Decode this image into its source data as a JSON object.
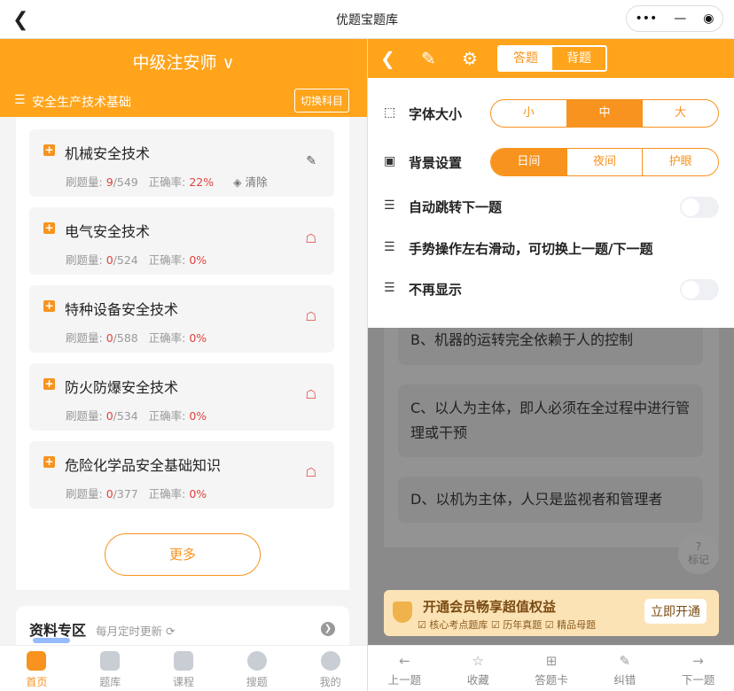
{
  "app": {
    "title": "优题宝题库"
  },
  "capsule": {
    "more": "•••",
    "min": "—",
    "close": "◉"
  },
  "left": {
    "exam": "中级注安师",
    "subject": "安全生产技术基础",
    "switch_label": "切换科目",
    "items": [
      {
        "name": "机械安全技术",
        "done_label": "刷题量:",
        "done": "9",
        "total": "/549",
        "rate_label": "正确率:",
        "rate": "22%",
        "clear": "清除"
      },
      {
        "name": "电气安全技术",
        "done_label": "刷题量:",
        "done": "0",
        "total": "/524",
        "rate_label": "正确率:",
        "rate": "0%"
      },
      {
        "name": "特种设备安全技术",
        "done_label": "刷题量:",
        "done": "0",
        "total": "/588",
        "rate_label": "正确率:",
        "rate": "0%"
      },
      {
        "name": "防火防爆安全技术",
        "done_label": "刷题量:",
        "done": "0",
        "total": "/534",
        "rate_label": "正确率:",
        "rate": "0%"
      },
      {
        "name": "危险化学品安全基础知识",
        "done_label": "刷题量:",
        "done": "0",
        "total": "/377",
        "rate_label": "正确率:",
        "rate": "0%"
      }
    ],
    "more": "更多",
    "materials": {
      "title": "资料专区",
      "subtitle": "每月定时更新"
    },
    "nav": [
      "首页",
      "题库",
      "课程",
      "搜题",
      "我的"
    ]
  },
  "right": {
    "mode": {
      "answer": "答题",
      "recite": "背题"
    },
    "settings": {
      "font_label": "字体大小",
      "font_opts": [
        "小",
        "中",
        "大"
      ],
      "bg_label": "背景设置",
      "bg_opts": [
        "日间",
        "夜间",
        "护眼"
      ],
      "auto_next": "自动跳转下一题",
      "gesture": "手势操作左右滑动，可切换上一题/下一题",
      "no_show": "不再显示"
    },
    "options": {
      "b": "B、机器的运转完全依赖于人的控制",
      "c": "C、以人为主体，即人必须在全过程中进行管理或干预",
      "d": "D、以机为主体，人只是监视者和管理者"
    },
    "mark": "标记",
    "vip": {
      "title": "开通会员畅享超值权益",
      "perks": "☑ 核心考点题库   ☑ 历年真题   ☑ 精品母题",
      "button": "立即开通"
    },
    "nav": [
      "上一题",
      "收藏",
      "答题卡",
      "纠错",
      "下一题"
    ]
  },
  "colors": {
    "accent": "#ffa41b",
    "red": "#e0433e"
  }
}
